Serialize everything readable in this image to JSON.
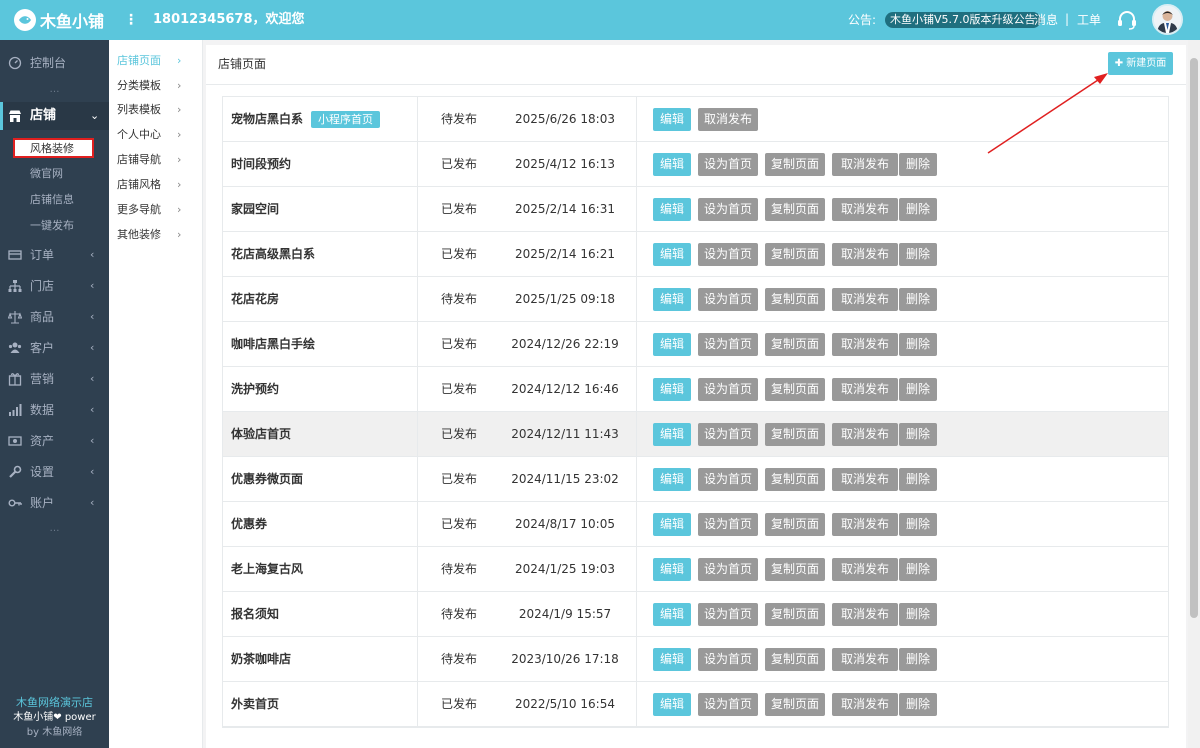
{
  "header": {
    "logo_text": "木鱼小铺",
    "menu_icon": "⋮",
    "welcome": "18012345678，欢迎您",
    "notice_label": "公告:",
    "notice_text": "木鱼小铺V5.7.0版本升级公告",
    "messages": "消息",
    "separator": "|",
    "work_order": "工单",
    "accent": "#5bc6dc"
  },
  "sidebar": {
    "items": [
      {
        "label": "控制台",
        "icon": "dashboard-icon"
      },
      {
        "label": "店铺",
        "icon": "shop-icon",
        "active": true
      },
      {
        "label": "订单",
        "icon": "order-icon"
      },
      {
        "label": "门店",
        "icon": "store-icon"
      },
      {
        "label": "商品",
        "icon": "goods-icon"
      },
      {
        "label": "客户",
        "icon": "users-icon"
      },
      {
        "label": "营销",
        "icon": "marketing-icon"
      },
      {
        "label": "数据",
        "icon": "chart-icon"
      },
      {
        "label": "资产",
        "icon": "asset-icon"
      },
      {
        "label": "设置",
        "icon": "wrench-icon"
      },
      {
        "label": "账户",
        "icon": "key-icon"
      }
    ],
    "more": "…",
    "subitems": [
      "风格装修",
      "微官网",
      "店铺信息",
      "一键发布"
    ],
    "footer_shop": "木鱼网络演示店",
    "footer_power": "木鱼小铺❤ power",
    "footer_by": "by 木鱼网络"
  },
  "subnav": {
    "items": [
      "店铺页面",
      "分类模板",
      "列表模板",
      "个人中心",
      "店铺导航",
      "店铺风格",
      "更多导航",
      "其他装修"
    ],
    "arrow": "›"
  },
  "panel": {
    "title": "店铺页面",
    "new_button": "✚ 新建页面"
  },
  "buttons": {
    "edit": "编辑",
    "set_home": "设为首页",
    "copy": "复制页面",
    "unpublish": "取消发布",
    "delete": "删除"
  },
  "pages": [
    {
      "name": "宠物店黑白系",
      "tag": "小程序首页",
      "status": "待发布",
      "time": "2025/6/26 18:03"
    },
    {
      "name": "时间段预约",
      "status": "已发布",
      "time": "2025/4/12 16:13"
    },
    {
      "name": "家园空间",
      "status": "已发布",
      "time": "2025/2/14 16:31"
    },
    {
      "name": "花店高级黑白系",
      "status": "已发布",
      "time": "2025/2/14 16:21"
    },
    {
      "name": "花店花房",
      "status": "待发布",
      "time": "2025/1/25 09:18"
    },
    {
      "name": "咖啡店黑白手绘",
      "status": "已发布",
      "time": "2024/12/26 22:19"
    },
    {
      "name": "洗护预约",
      "status": "已发布",
      "time": "2024/12/12 16:46"
    },
    {
      "name": "体验店首页",
      "status": "已发布",
      "time": "2024/12/11 11:43"
    },
    {
      "name": "优惠券微页面",
      "status": "已发布",
      "time": "2024/11/15 23:02"
    },
    {
      "name": "优惠券",
      "status": "已发布",
      "time": "2024/8/17 10:05"
    },
    {
      "name": "老上海复古风",
      "status": "待发布",
      "time": "2024/1/25 19:03"
    },
    {
      "name": "报名须知",
      "status": "待发布",
      "time": "2024/1/9 15:57"
    },
    {
      "name": "奶茶咖啡店",
      "status": "待发布",
      "time": "2023/10/26 17:18"
    },
    {
      "name": "外卖首页",
      "status": "已发布",
      "time": "2022/5/10 16:54"
    }
  ]
}
